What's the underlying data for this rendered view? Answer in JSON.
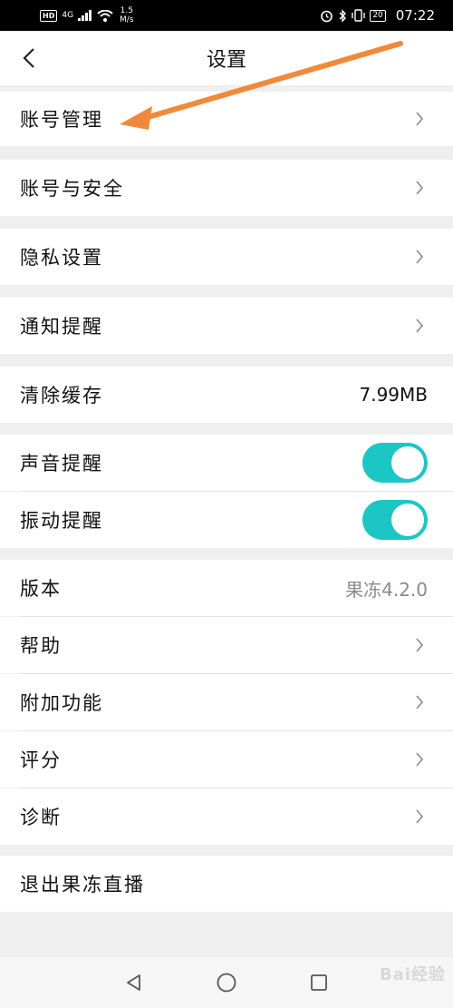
{
  "status_bar": {
    "hd": "HD",
    "network": "4G",
    "speed_value": "1.5",
    "speed_unit": "M/s",
    "battery": "20",
    "time": "07:22"
  },
  "header": {
    "title": "设置",
    "back_icon": "chevron-left-icon"
  },
  "sections": {
    "account_management": {
      "label": "账号管理"
    },
    "account_security": {
      "label": "账号与安全"
    },
    "privacy": {
      "label": "隐私设置"
    },
    "notifications": {
      "label": "通知提醒"
    },
    "clear_cache": {
      "label": "清除缓存",
      "value": "7.99MB"
    },
    "sound_alert": {
      "label": "声音提醒",
      "enabled": true
    },
    "vibration_alert": {
      "label": "振动提醒",
      "enabled": true
    },
    "version": {
      "label": "版本",
      "value": "果冻4.2.0"
    },
    "help": {
      "label": "帮助"
    },
    "addons": {
      "label": "附加功能"
    },
    "rating": {
      "label": "评分"
    },
    "diagnosis": {
      "label": "诊断"
    },
    "logout": {
      "label": "退出果冻直播"
    }
  },
  "colors": {
    "toggle_on": "#1cc6c4",
    "annotation_arrow": "#f08a3a"
  },
  "watermark": "Bai经验"
}
